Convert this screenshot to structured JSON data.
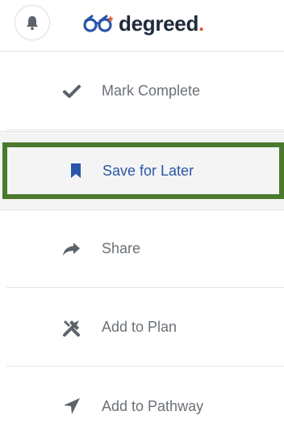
{
  "header": {
    "logo_text": "degreed",
    "logo_dot": ".",
    "notification_icon": "bell-icon"
  },
  "menu": {
    "items": [
      {
        "label": "Mark Complete",
        "icon": "checkmark-icon"
      },
      {
        "label": "Save for Later",
        "icon": "bookmark-icon",
        "active": true
      },
      {
        "label": "Share",
        "icon": "share-arrow-icon"
      },
      {
        "label": "Add to Plan",
        "icon": "tools-icon"
      },
      {
        "label": "Add to Pathway",
        "icon": "navigation-arrow-icon"
      }
    ]
  },
  "colors": {
    "brand_blue": "#2a56a8",
    "logo_dot": "#e05b3a",
    "focus_border": "#4a7a2c",
    "icon_gray": "#5c636b",
    "text_gray": "#6b7178"
  }
}
